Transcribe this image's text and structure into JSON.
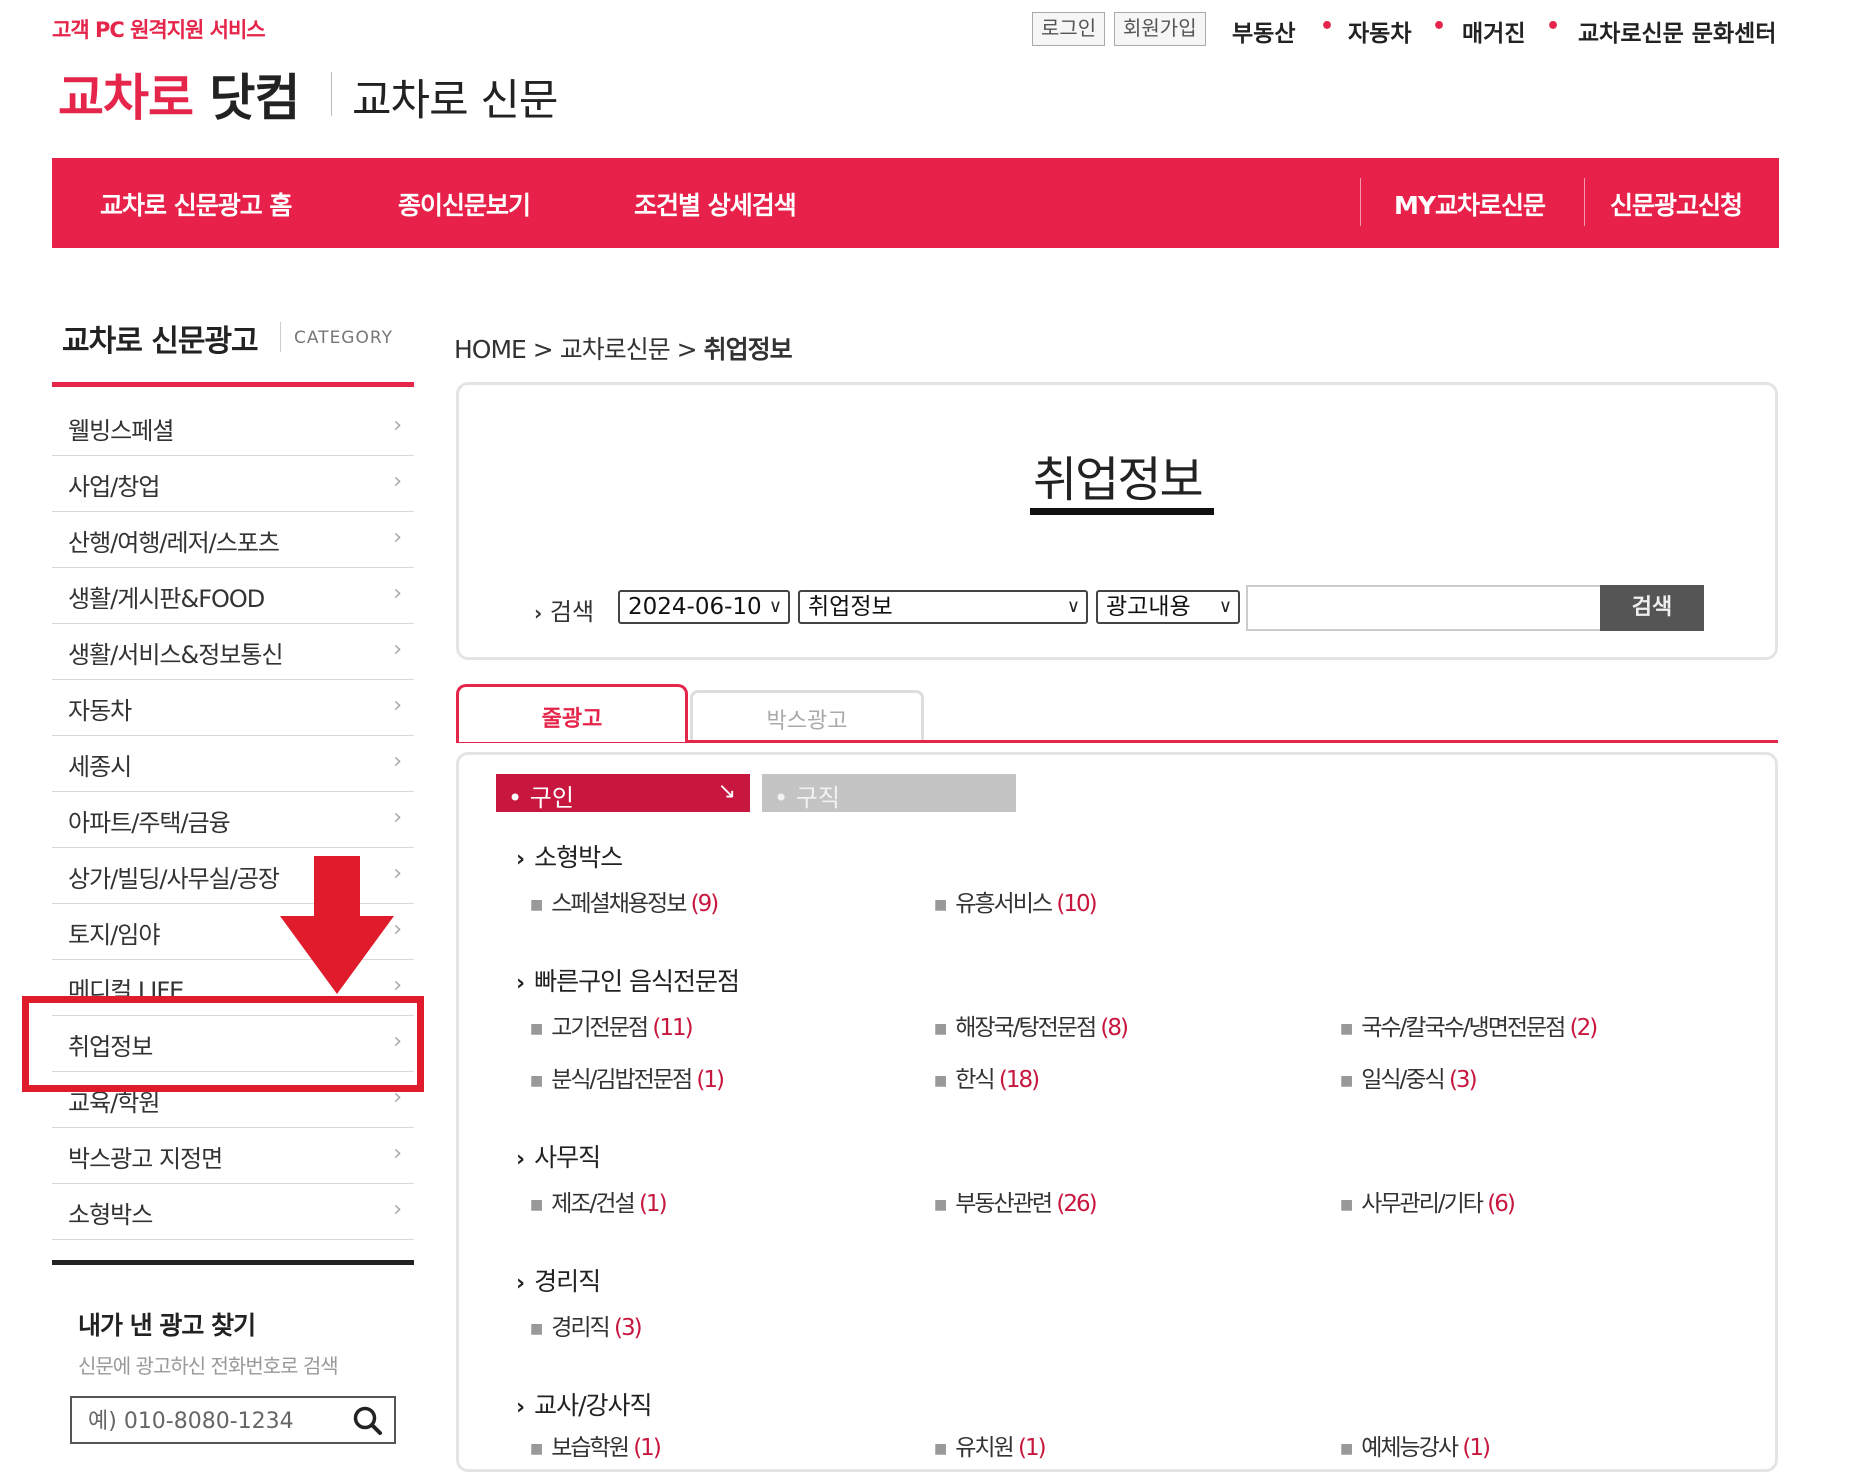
{
  "header": {
    "remote_support": "고객 PC 원격지원 서비스",
    "logo_brand_red": "교차로",
    "logo_brand_dark": "닷컴",
    "logo_sub": "교차로 신문",
    "login": "로그인",
    "signup": "회원가입",
    "links": [
      "부동산",
      "자동차",
      "매거진",
      "교차로신문 문화센터"
    ],
    "brand_color": "#e8214a"
  },
  "nav": {
    "items": [
      "교차로 신문광고 홈",
      "종이신문보기",
      "조건별 상세검색"
    ],
    "right_items": [
      "MY교차로신문",
      "신문광고신청"
    ]
  },
  "sidebar": {
    "title": "교차로 신문광고",
    "category_label": "CATEGORY",
    "items": [
      "웰빙스페셜",
      "사업/창업",
      "산행/여행/레저/스포츠",
      "생활/게시판&FOOD",
      "생활/서비스&정보통신",
      "자동차",
      "세종시",
      "아파트/주택/금융",
      "상가/빌딩/사무실/공장",
      "토지/임야",
      "메디컬 LIFE",
      "취업정보",
      "교육/학원",
      "박스광고 지정면",
      "소형박스"
    ],
    "my_ad": {
      "title": "내가 낸 광고 찾기",
      "subtitle": "신문에 광고하신 전화번호로 검색",
      "placeholder": "예) 010-8080-1234"
    }
  },
  "breadcrumb": {
    "home": "HOME",
    "level1": "교차로신문",
    "current": "취업정보",
    "sep": ">"
  },
  "search": {
    "page_title": "취업정보",
    "label": "검색",
    "date_value": "2024-06-10",
    "category_value": "취업정보",
    "field_value": "광고내용",
    "button": "검색"
  },
  "tabs": {
    "line_ad": "줄광고",
    "box_ad": "박스광고"
  },
  "subtabs": {
    "hire": "구인",
    "seek": "구직",
    "hire_arrow": "↘"
  },
  "sections": [
    {
      "title": "소형박스",
      "items": [
        {
          "label": "스페셜채용정보",
          "count": "9"
        },
        {
          "label": "유흥서비스",
          "count": "10"
        }
      ]
    },
    {
      "title": "빠른구인 음식전문점",
      "items": [
        {
          "label": "고기전문점",
          "count": "11"
        },
        {
          "label": "해장국/탕전문점",
          "count": "8"
        },
        {
          "label": "국수/칼국수/냉면전문점",
          "count": "2"
        },
        {
          "label": "분식/김밥전문점",
          "count": "1"
        },
        {
          "label": "한식",
          "count": "18"
        },
        {
          "label": "일식/중식",
          "count": "3"
        }
      ]
    },
    {
      "title": "사무직",
      "items": [
        {
          "label": "제조/건설",
          "count": "1"
        },
        {
          "label": "부동산관련",
          "count": "26"
        },
        {
          "label": "사무관리/기타",
          "count": "6"
        }
      ]
    },
    {
      "title": "경리직",
      "items": [
        {
          "label": "경리직",
          "count": "3"
        }
      ]
    },
    {
      "title": "교사/강사직",
      "items": [
        {
          "label": "보습학원",
          "count": "1"
        },
        {
          "label": "유치원",
          "count": "1"
        },
        {
          "label": "예체능강사",
          "count": "1"
        }
      ]
    }
  ],
  "annotation": {
    "highlight_color": "#e01b2c",
    "target": "취업정보"
  }
}
